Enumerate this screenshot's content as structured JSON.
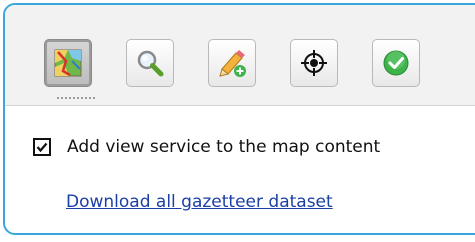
{
  "toolbar": {
    "tools": [
      {
        "icon": "map-icon",
        "active": true
      },
      {
        "icon": "magnifier-icon",
        "active": false
      },
      {
        "icon": "pencil-add-icon",
        "active": false
      },
      {
        "icon": "crosshair-icon",
        "active": false
      },
      {
        "icon": "check-circle-icon",
        "active": false
      }
    ]
  },
  "options": {
    "add_view_service": {
      "checked": true,
      "label": "Add view service to the map content"
    }
  },
  "links": {
    "download_gazetteer": "Download all gazetteer dataset"
  },
  "colors": {
    "panel_border": "#3aa6dc",
    "link": "#1a3fa6",
    "check_green": "#3db34a"
  }
}
